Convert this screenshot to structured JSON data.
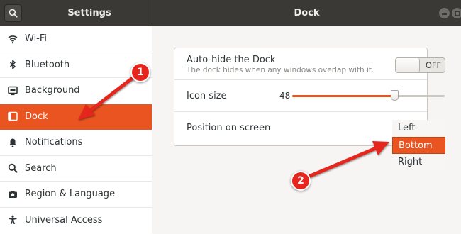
{
  "header": {
    "settings_title": "Settings",
    "page_title": "Dock"
  },
  "sidebar": {
    "items": [
      {
        "label": "Wi-Fi",
        "icon": "wifi-icon"
      },
      {
        "label": "Bluetooth",
        "icon": "bluetooth-icon"
      },
      {
        "label": "Background",
        "icon": "background-icon"
      },
      {
        "label": "Dock",
        "icon": "dock-icon",
        "active": true
      },
      {
        "label": "Notifications",
        "icon": "bell-icon"
      },
      {
        "label": "Search",
        "icon": "search-icon"
      },
      {
        "label": "Region & Language",
        "icon": "camera-icon"
      },
      {
        "label": "Universal Access",
        "icon": "accessibility-icon"
      }
    ]
  },
  "dock": {
    "autohide": {
      "title": "Auto-hide the Dock",
      "subtitle": "The dock hides when any windows overlap with it.",
      "toggle_label": "OFF",
      "enabled": false
    },
    "icon_size": {
      "title": "Icon size",
      "value": "48",
      "slider_fraction": 0.67
    },
    "position": {
      "title": "Position on screen",
      "options": [
        "Left",
        "Bottom",
        "Right"
      ],
      "selected": "Bottom"
    }
  },
  "annotations": {
    "badge_1": "1",
    "badge_2": "2"
  },
  "colors": {
    "accent": "#e95420",
    "annotation_red": "#e5251e",
    "header": "#3b3936"
  }
}
